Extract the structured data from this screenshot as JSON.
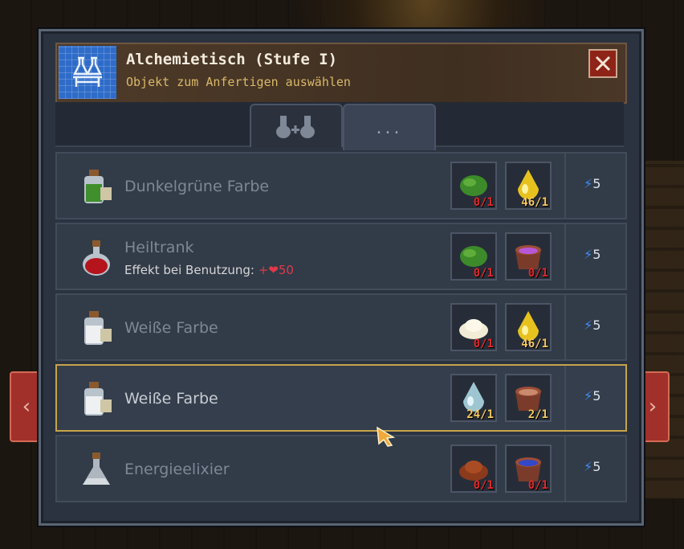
{
  "header": {
    "title": "Alchemietisch (Stufe I)",
    "subtitle": "Objekt zum Anfertigen auswählen",
    "icon": "blueprint-flasks-icon",
    "close_icon": "close-icon"
  },
  "tabs": [
    {
      "icon": "flasks-icon"
    },
    {
      "label": "..."
    }
  ],
  "recipes": [
    {
      "name": "Dunkelgrüne Farbe",
      "icon": "green-paint-bottle-icon",
      "ingredients": [
        {
          "icon": "green-moss-icon",
          "count": "0/1"
        },
        {
          "icon": "yellow-drop-icon",
          "count": "46/1"
        }
      ],
      "energy": "5"
    },
    {
      "name": "Heiltrank",
      "icon": "red-potion-icon",
      "effect_label": "Effekt bei Benutzung:",
      "effect_value": "+❤50",
      "ingredients": [
        {
          "icon": "green-moss-icon",
          "count": "0/1"
        },
        {
          "icon": "purple-bowl-icon",
          "count": "0/1"
        }
      ],
      "energy": "5"
    },
    {
      "name": "Weiße Farbe",
      "icon": "white-paint-bottle-icon",
      "ingredients": [
        {
          "icon": "white-powder-icon",
          "count": "0/1"
        },
        {
          "icon": "yellow-drop-icon",
          "count": "46/1"
        }
      ],
      "energy": "5"
    },
    {
      "name": "Weiße Farbe",
      "icon": "white-paint-bottle-icon",
      "ingredients": [
        {
          "icon": "water-drop-icon",
          "count": "24/1"
        },
        {
          "icon": "brown-bowl-icon",
          "count": "2/1"
        }
      ],
      "energy": "5"
    },
    {
      "name": "Energieelixier",
      "icon": "energy-flask-icon",
      "ingredients": [
        {
          "icon": "brown-powder-icon",
          "count": "0/1"
        },
        {
          "icon": "blue-bowl-icon",
          "count": "0/1"
        }
      ],
      "energy": "5"
    }
  ],
  "energy_symbol": "⚡",
  "nav": {
    "prev": "‹",
    "next": "›"
  },
  "colors": {
    "missing": "#e0282a",
    "available": "#f4c860",
    "selected_border": "#c7a44a"
  }
}
